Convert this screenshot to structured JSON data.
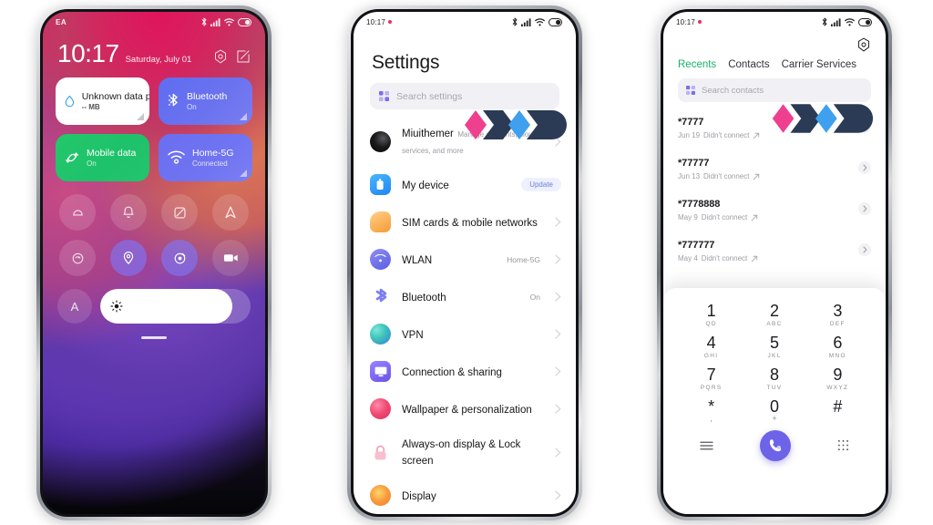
{
  "control_center": {
    "status_bar": {
      "carrier": "EA",
      "icons": [
        "bluetooth-icon",
        "signal-icon",
        "wifi-icon",
        "battery-icon"
      ]
    },
    "clock": "10:17",
    "date": "Saturday, July 01",
    "header_actions": [
      "settings-gear-icon",
      "edit-icon"
    ],
    "tiles": [
      {
        "title": "Unknown data plan",
        "subtitle": "-- MB",
        "icon": "data-usage-icon",
        "state": "white"
      },
      {
        "title": "Bluetooth",
        "subtitle": "On",
        "icon": "bluetooth-icon",
        "state": "blue"
      },
      {
        "title": "Mobile data",
        "subtitle": "On",
        "icon": "mobile-data-icon",
        "state": "green"
      },
      {
        "title": "Home-5G",
        "subtitle": "Connected",
        "icon": "wifi-icon",
        "state": "blue"
      }
    ],
    "toggles": [
      {
        "name": "do-not-disturb-icon",
        "active": false
      },
      {
        "name": "notification-bell-icon",
        "active": false
      },
      {
        "name": "screenshot-icon",
        "active": false
      },
      {
        "name": "navigation-arrow-icon",
        "active": false
      },
      {
        "name": "sync-icon",
        "active": false
      },
      {
        "name": "location-icon",
        "active": true
      },
      {
        "name": "gps-target-icon",
        "active": true
      },
      {
        "name": "screen-record-icon",
        "active": false
      }
    ],
    "brightness": {
      "auto_label": "A",
      "icon": "brightness-sun-icon",
      "level_percent": 88
    },
    "pull_handle": "drag-handle"
  },
  "settings": {
    "status_bar": {
      "time": "10:17",
      "icons": [
        "bluetooth-icon",
        "signal-icon",
        "wifi-icon",
        "battery-icon"
      ]
    },
    "title": "Settings",
    "search": {
      "placeholder": "Search settings",
      "icon": "search-grid-icon"
    },
    "items": [
      {
        "name": "Miuithemer",
        "sub": "Manage accounts, cloud services, and more",
        "value": "",
        "icon": "account-avatar",
        "color": "#0d0d0f",
        "badge": "",
        "chevron": true
      },
      {
        "name": "My device",
        "sub": "",
        "value": "",
        "icon": "device-icon",
        "color": "#2e9bf5",
        "badge": "Update",
        "chevron": false
      },
      {
        "name": "SIM cards & mobile networks",
        "sub": "",
        "value": "",
        "icon": "sim-card-icon",
        "color": "#f6a94a",
        "badge": "",
        "chevron": true
      },
      {
        "name": "WLAN",
        "sub": "",
        "value": "Home-5G",
        "icon": "wlan-icon",
        "color": "#6f74e8",
        "badge": "",
        "chevron": true
      },
      {
        "name": "Bluetooth",
        "sub": "",
        "value": "On",
        "icon": "bluetooth-icon",
        "color": "#6f7ef0",
        "badge": "",
        "chevron": true
      },
      {
        "name": "VPN",
        "sub": "",
        "value": "",
        "icon": "vpn-globe-icon",
        "color": "#3fc4b6",
        "badge": "",
        "chevron": true
      },
      {
        "name": "Connection & sharing",
        "sub": "",
        "value": "",
        "icon": "connection-sharing-icon",
        "color": "#7a67ef",
        "badge": "",
        "chevron": true
      },
      {
        "name": "Wallpaper & personalization",
        "sub": "",
        "value": "",
        "icon": "wallpaper-palette-icon",
        "color": "#ef5a7e",
        "badge": "",
        "chevron": true
      },
      {
        "name": "Always-on display & Lock screen",
        "sub": "",
        "value": "",
        "icon": "lock-icon",
        "color": "#f6b2c2",
        "badge": "",
        "chevron": true
      },
      {
        "name": "Display",
        "sub": "",
        "value": "",
        "icon": "display-brightness-icon",
        "color": "#f79a3c",
        "badge": "",
        "chevron": true
      }
    ]
  },
  "dialer": {
    "status_bar": {
      "time": "10:17",
      "icons": [
        "bluetooth-icon",
        "signal-icon",
        "wifi-icon",
        "battery-icon"
      ]
    },
    "gear": "settings-gear-icon",
    "tabs": [
      {
        "label": "Recents",
        "active": true
      },
      {
        "label": "Contacts",
        "active": false
      },
      {
        "label": "Carrier Services",
        "active": false
      }
    ],
    "search": {
      "placeholder": "Search contacts",
      "icon": "search-grid-icon"
    },
    "calls": [
      {
        "number": "*7777",
        "date": "Jun 19",
        "status": "Didn't connect",
        "direction": "outgoing-arrow-icon"
      },
      {
        "number": "*77777",
        "date": "Jun 13",
        "status": "Didn't connect",
        "direction": "outgoing-arrow-icon"
      },
      {
        "number": "*7778888",
        "date": "May 9",
        "status": "Didn't connect",
        "direction": "outgoing-arrow-icon"
      },
      {
        "number": "*777777",
        "date": "May 4",
        "status": "Didn't connect",
        "direction": "outgoing-arrow-icon"
      }
    ],
    "keypad": [
      {
        "digit": "1",
        "letters": "QD"
      },
      {
        "digit": "2",
        "letters": "ABC"
      },
      {
        "digit": "3",
        "letters": "DEF"
      },
      {
        "digit": "4",
        "letters": "GHI"
      },
      {
        "digit": "5",
        "letters": "JKL"
      },
      {
        "digit": "6",
        "letters": "MNO"
      },
      {
        "digit": "7",
        "letters": "PQRS"
      },
      {
        "digit": "8",
        "letters": "TUV"
      },
      {
        "digit": "9",
        "letters": "WXYZ"
      },
      {
        "digit": "*",
        "letters": ","
      },
      {
        "digit": "0",
        "letters": "+"
      },
      {
        "digit": "#",
        "letters": ""
      }
    ],
    "actions": {
      "menu": "menu-lines-icon",
      "call": "call-phone-icon",
      "keypad": "keypad-grid-icon"
    }
  },
  "watermark": {
    "name": "brand-logo-watermark",
    "colors": {
      "pink": "#ef3f8f",
      "navy": "#2b3b55",
      "blue": "#3ea0ee"
    }
  },
  "theme": {
    "page_background": "#ffffff",
    "accent_purple": "#6c63e8",
    "accent_green": "#18b46a",
    "tile_green": "#24c76a",
    "tile_blue": "#6b73ef"
  }
}
